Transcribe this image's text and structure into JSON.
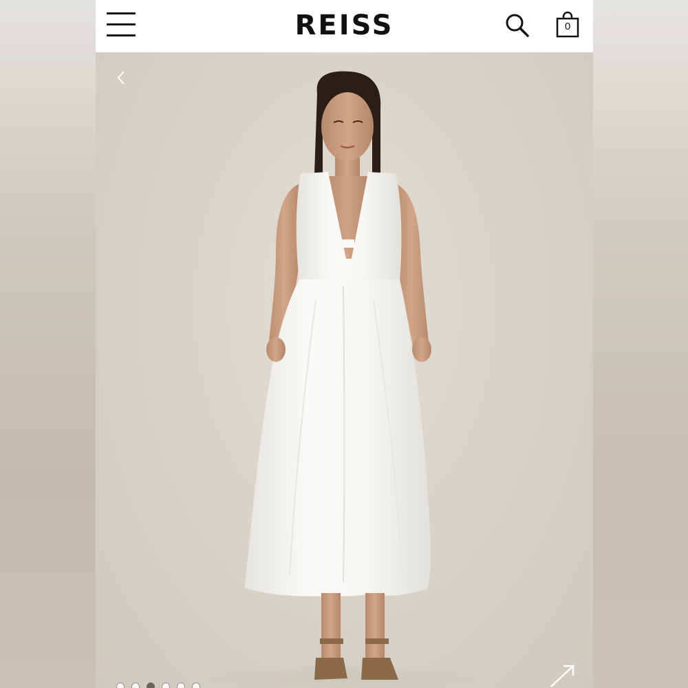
{
  "header": {
    "brand": "REISS",
    "bag_count": "0"
  },
  "icons": {
    "menu": "hamburger-icon",
    "search": "search-icon",
    "bag": "shopping-bag-icon",
    "prev": "chevron-left-icon",
    "expand": "expand-diagonal-arrow-icon"
  },
  "gallery": {
    "slide_count": 6,
    "active_slide": 3
  },
  "colors": {
    "header_bg": "#ffffff",
    "brand_text": "#111111",
    "backdrop": "#d9d5cc",
    "dress": "#f7f6f3"
  }
}
